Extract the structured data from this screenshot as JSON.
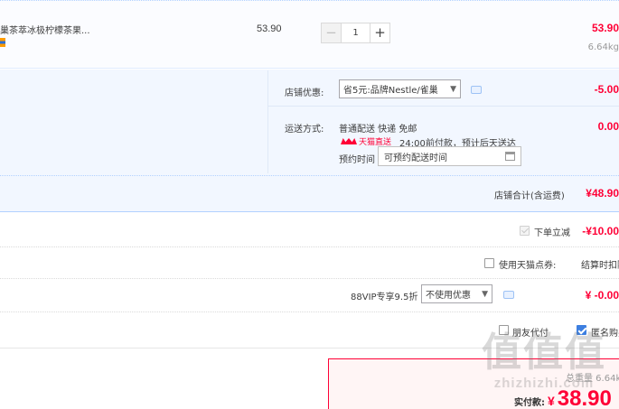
{
  "product": {
    "title": "巢茶萃冰极柠檬茶果...",
    "unit_price": "53.90",
    "quantity": "1",
    "minus_symbol": "−",
    "plus_symbol": "+",
    "subtotal": "53.90",
    "weight": "6.64kg"
  },
  "shop_promo": {
    "label": "店铺优惠:",
    "selected": "省5元:品牌Nestle/雀巢",
    "value": "-5.00"
  },
  "shipping": {
    "label": "运送方式:",
    "method": "普通配送 快递 免邮",
    "badge": "天猫直送",
    "note": "24:00前付款，预计后天送达",
    "reserve_label": "预约时间",
    "reserve_placeholder": "可预约配送时间",
    "value": "0.00"
  },
  "shop_total": {
    "label": "店铺合计(含运费)",
    "value": "¥48.90"
  },
  "order_discount": {
    "label": "下单立减",
    "value": "-¥10.00"
  },
  "tmall_points": {
    "label": "使用天猫点券:",
    "note": "结算时扣除"
  },
  "vip": {
    "label": "88VIP专享9.5折",
    "selected": "不使用优惠",
    "value": "¥ -0.00"
  },
  "options": {
    "friend_pay": "朋友代付",
    "anonymous": "匿名购买"
  },
  "payment": {
    "label": "实付款:",
    "currency": "¥",
    "amount": "38.90",
    "weight": "总重量 6.64kg"
  },
  "watermark": {
    "logo": "值值值",
    "site": "zhizhizhi.com"
  },
  "colors": {
    "price_red": "#ff0036",
    "accent_blue": "#3d7fe0",
    "panel_bg": "#f2f7ff"
  }
}
